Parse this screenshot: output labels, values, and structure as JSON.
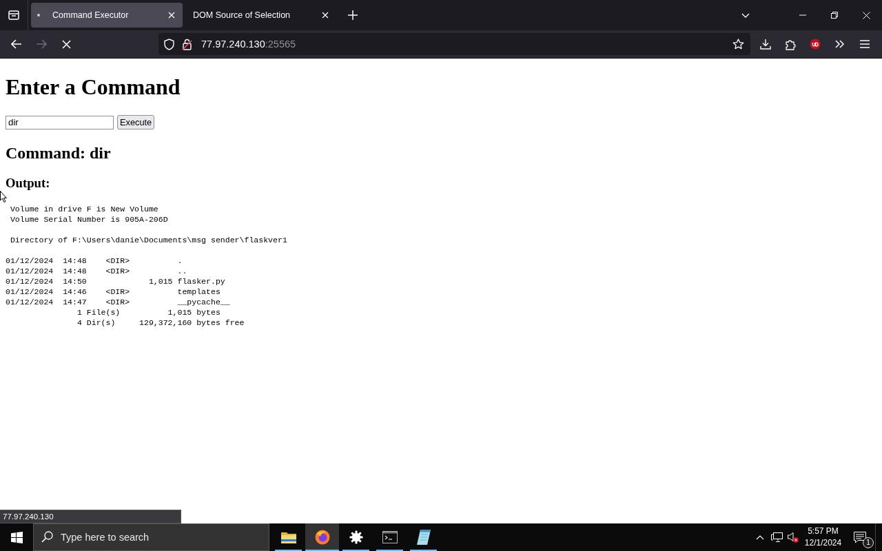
{
  "browser": {
    "tabs": [
      {
        "title": "Command Executor",
        "selected": true,
        "loading": true
      },
      {
        "title": "DOM Source of Selection",
        "selected": false,
        "loading": false
      }
    ],
    "navigation": {
      "back": {
        "disabled": false
      },
      "forward": {
        "disabled": true
      },
      "loading": true
    },
    "address": {
      "host": "77.97.240.130",
      "port": ":25565"
    },
    "status_text": "77.97.240.130"
  },
  "page": {
    "heading": "Enter a Command",
    "command_field": {
      "value": "dir"
    },
    "execute_button": "Execute",
    "command_heading": "Command: dir",
    "output_heading": "Output:",
    "output": [
      [
        " Volume in drive F is New Volume",
        " Volume Serial Number is 905A-206D"
      ],
      [
        " Directory of F:\\Users\\danie\\Documents\\msg sender\\flaskver1"
      ],
      [
        "01/12/2024  14:48    <DIR>          .",
        "01/12/2024  14:48    <DIR>          ..",
        "01/12/2024  14:50             1,015 flasker.py",
        "01/12/2024  14:46    <DIR>          templates",
        "01/12/2024  14:47    <DIR>          __pycache__",
        "               1 File(s)          1,015 bytes",
        "               4 Dir(s)     129,372,160 bytes free"
      ]
    ]
  },
  "taskbar": {
    "search": {
      "placeholder": "Type here to search"
    },
    "apps": [
      {
        "kind": "files",
        "active": false,
        "running": true
      },
      {
        "kind": "browser",
        "active": true,
        "running": true
      },
      {
        "kind": "settings",
        "active": false,
        "running": true
      },
      {
        "kind": "terminal",
        "active": false,
        "running": true
      },
      {
        "kind": "notepad",
        "active": false,
        "running": true
      }
    ],
    "clock": {
      "time": "5:57 PM",
      "date": "12/1/2024"
    },
    "notifications": {
      "count": "1"
    }
  }
}
